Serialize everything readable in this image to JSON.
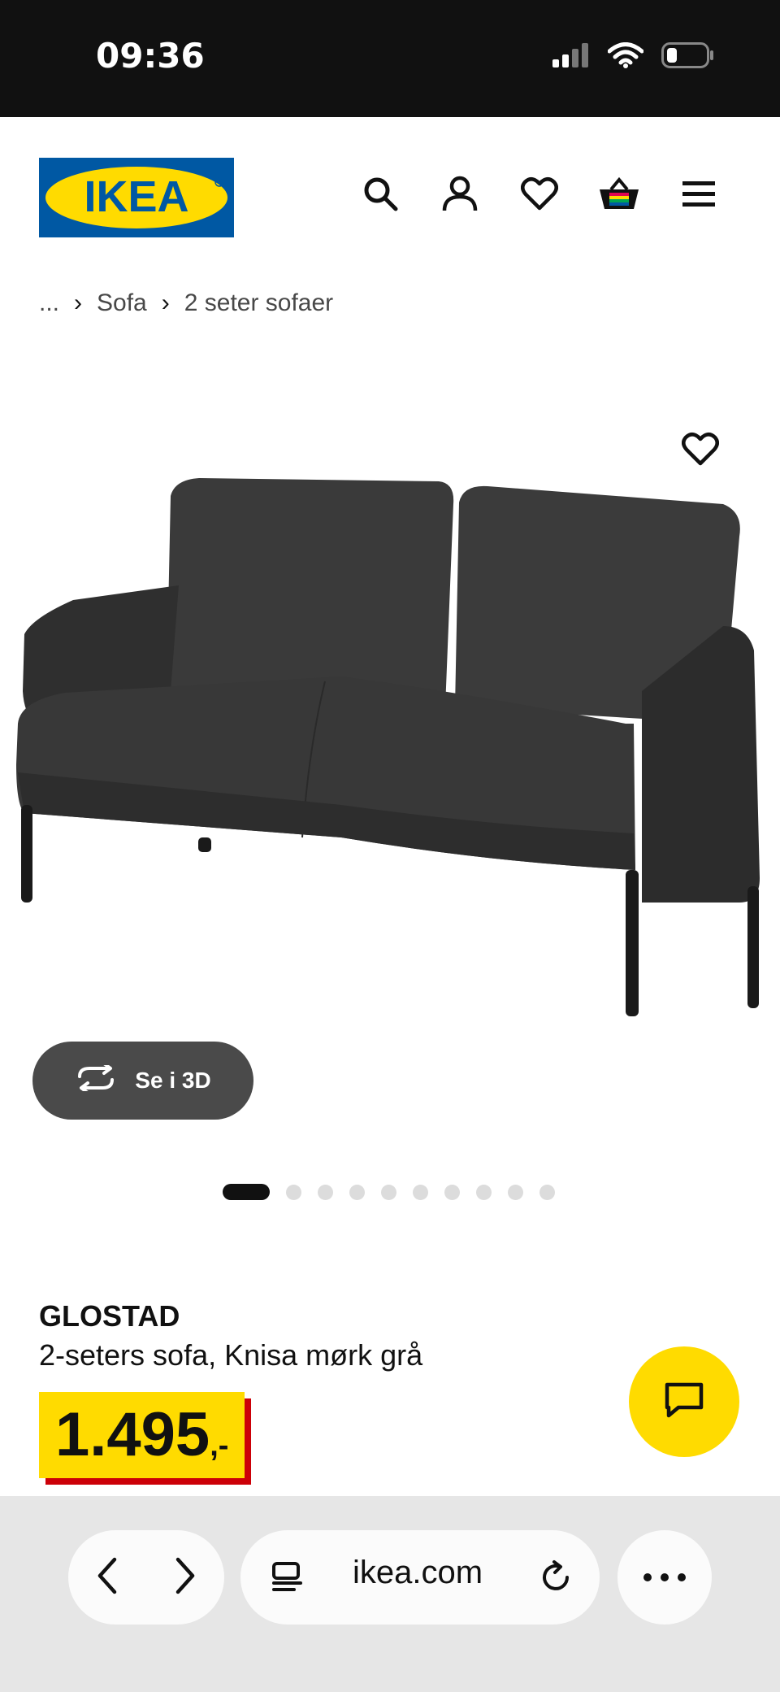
{
  "status_bar": {
    "time": "09:36"
  },
  "header": {
    "logo_text": "IKEA"
  },
  "breadcrumb": {
    "ellipsis": "...",
    "items": [
      "Sofa",
      "2 seter sofaer"
    ],
    "separator": "›"
  },
  "gallery": {
    "view_3d_label": "Se i 3D",
    "total_images": 10,
    "active_index": 0
  },
  "product": {
    "name": "GLOSTAD",
    "description": "2-seters sofa, Knisa mørk grå",
    "price_main": "1.495",
    "price_suffix": ",-"
  },
  "browser": {
    "url": "ikea.com"
  },
  "colors": {
    "ikea_blue": "#0058a3",
    "ikea_yellow": "#ffdb00",
    "price_shadow": "#cc0008"
  }
}
